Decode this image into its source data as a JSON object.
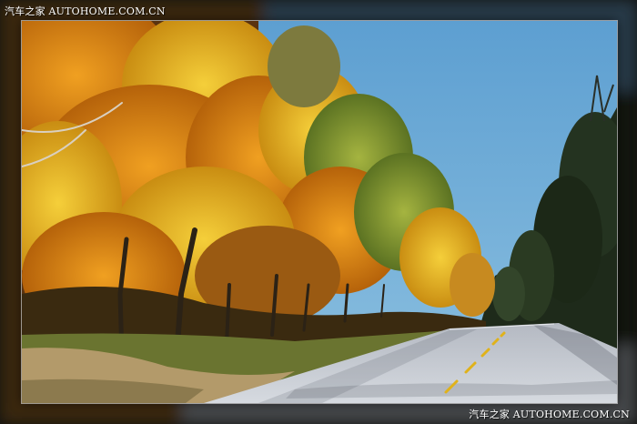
{
  "watermark": {
    "top_left": "汽车之家 AUTOHOME.COM.CN",
    "bottom_right": "汽车之家 AUTOHOME.COM.CN"
  },
  "colors": {
    "sky": "#6aa9d6",
    "road": "#c9ced6",
    "road_line": "#e0b21a",
    "foliage_orange": "#d9820f",
    "foliage_yellow": "#e6b21c",
    "foliage_green": "#7e9a2e",
    "dark_forest": "#1f2a1a",
    "grass": "#7c8a3a"
  }
}
